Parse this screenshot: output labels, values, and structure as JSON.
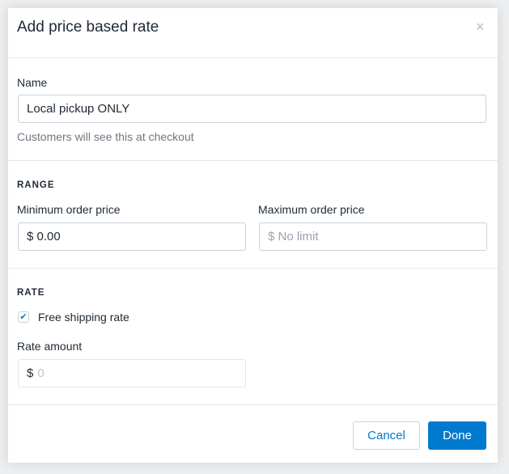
{
  "dialog": {
    "title": "Add price based rate",
    "close_icon": "×"
  },
  "name": {
    "label": "Name",
    "value": "Local pickup ONLY",
    "help": "Customers will see this at checkout"
  },
  "range": {
    "heading": "RANGE",
    "min_label": "Minimum order price",
    "min_value": "$ 0.00",
    "max_label": "Maximum order price",
    "max_placeholder": "$ No limit"
  },
  "rate": {
    "heading": "RATE",
    "free_shipping_label": "Free shipping rate",
    "free_shipping_checked": true,
    "check": "✔",
    "amount_label": "Rate amount",
    "currency": "$",
    "amount_placeholder": "0"
  },
  "footer": {
    "cancel": "Cancel",
    "done": "Done"
  },
  "colors": {
    "accent": "#007ace"
  }
}
